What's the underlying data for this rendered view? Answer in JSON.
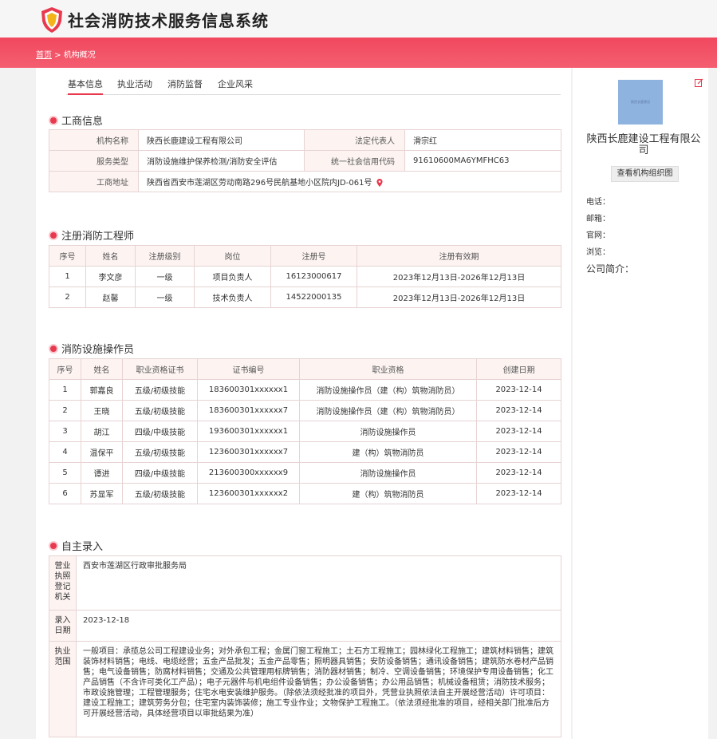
{
  "app": {
    "title": "社会消防技术服务信息系统"
  },
  "breadcrumb": {
    "home": "首页",
    "sep": " > ",
    "current": "机构概况"
  },
  "tabs": [
    {
      "label": "基本信息"
    },
    {
      "label": "执业活动"
    },
    {
      "label": "消防监督"
    },
    {
      "label": "企业风采"
    }
  ],
  "sections": {
    "business": "工商信息",
    "engineers": "注册消防工程师",
    "operators": "消防设施操作员",
    "self": "自主录入"
  },
  "business": {
    "org_name_label": "机构名称",
    "org_name": "陕西长鹿建设工程有限公司",
    "legal_label": "法定代表人",
    "legal": "滑宗红",
    "service_label": "服务类型",
    "service": "消防设施维护保养检测/消防安全评估",
    "credit_label": "统一社会信用代码",
    "credit": "91610600MA6YMFHC63",
    "address_label": "工商地址",
    "address": "陕西省西安市莲湖区劳动南路296号民航基地小区院内JD-061号"
  },
  "engineers": {
    "headers": [
      "序号",
      "姓名",
      "注册级别",
      "岗位",
      "注册号",
      "注册有效期"
    ],
    "rows": [
      [
        "1",
        "李文彦",
        "一级",
        "项目负责人",
        "16123000617",
        "2023年12月13日-2026年12月13日"
      ],
      [
        "2",
        "赵馨",
        "一级",
        "技术负责人",
        "14522000135",
        "2023年12月13日-2026年12月13日"
      ]
    ]
  },
  "operators": {
    "headers": [
      "序号",
      "姓名",
      "职业资格证书",
      "证书编号",
      "职业资格",
      "创建日期"
    ],
    "rows": [
      [
        "1",
        "郭嘉良",
        "五级/初级技能",
        "183600301xxxxxx1",
        "消防设施操作员（建（构）筑物消防员）",
        "2023-12-14"
      ],
      [
        "2",
        "王晓",
        "五级/初级技能",
        "183600301xxxxxx7",
        "消防设施操作员（建（构）筑物消防员）",
        "2023-12-14"
      ],
      [
        "3",
        "胡江",
        "四级/中级技能",
        "193600301xxxxxx1",
        "消防设施操作员",
        "2023-12-14"
      ],
      [
        "4",
        "温保平",
        "五级/初级技能",
        "123600301xxxxxx7",
        "建（构）筑物消防员",
        "2023-12-14"
      ],
      [
        "5",
        "谭进",
        "四级/中级技能",
        "213600300xxxxxx9",
        "消防设施操作员",
        "2023-12-14"
      ],
      [
        "6",
        "苏显军",
        "五级/初级技能",
        "123600301xxxxxx2",
        "建（构）筑物消防员",
        "2023-12-14"
      ]
    ]
  },
  "self_entry": {
    "registry_label": "营业执照登记机关",
    "registry": "西安市莲湖区行政审批服务局",
    "date_label": "录入日期",
    "date": "2023-12-18",
    "scope_label": "执业范围",
    "scope": "一般项目：承揽总公司工程建设业务；对外承包工程；金属门窗工程施工；土石方工程施工；园林绿化工程施工；建筑材料销售；建筑装饰材料销售；电线、电缆经营；五金产品批发；五金产品零售；照明器具销售；安防设备销售；通讯设备销售；建筑防水卷材产品销售；电气设备销售；防腐材料销售；交通及公共管理用标牌销售；消防器材销售；制冷、空调设备销售；环境保护专用设备销售；化工产品销售（不含许可类化工产品）；电子元器件与机电组件设备销售；办公设备销售；办公用品销售；机械设备租赁；消防技术服务；市政设施管理；工程管理服务；住宅水电安装维护服务。（除依法须经批准的项目外，凭营业执照依法自主开展经营活动）许可项目：建设工程施工；建筑劳务分包；住宅室内装饰装修；施工专业作业；文物保护工程施工。（依法须经批准的项目，经相关部门批准后方可开展经营活动，具体经营项目以审批结果为准）"
  },
  "sidebar": {
    "image_text": "陕西长鹿建设",
    "org_name": "陕西长鹿建设工程有限公司",
    "org_chart_button": "查看机构组织图",
    "phone_label": "电话：",
    "email_label": "邮箱：",
    "website_label": "官网：",
    "views_label": "浏览：",
    "intro_label": "公司简介："
  },
  "colors": {
    "accent": "#e8394e",
    "header_band": "#f1485e"
  },
  "icons": {
    "logo": "shield-logo-icon",
    "location": "map-pin-icon",
    "edit": "edit-icon"
  }
}
